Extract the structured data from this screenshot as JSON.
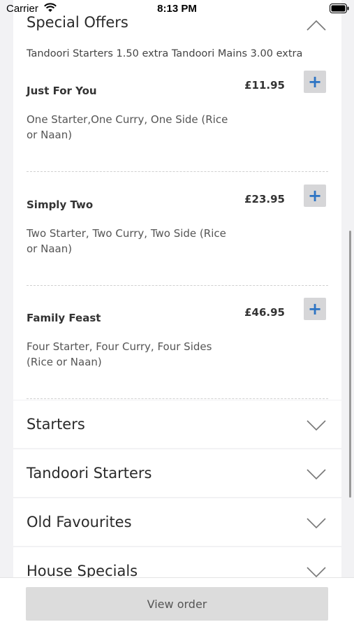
{
  "status_bar": {
    "carrier": "Carrier",
    "time": "8:13 PM"
  },
  "special_offers": {
    "title": "Special Offers",
    "note": "Tandoori Starters 1.50 extra Tandoori Mains 3.00 extra",
    "items": [
      {
        "name": "Just For You",
        "price": "£11.95",
        "description": "One Starter,One Curry, One Side (Rice or Naan)",
        "add_label": "+"
      },
      {
        "name": "Simply Two",
        "price": "£23.95",
        "description": "Two Starter, Two Curry, Two Side (Rice or Naan)",
        "add_label": "+"
      },
      {
        "name": "Family Feast",
        "price": "£46.95",
        "description": "Four Starter, Four Curry, Four Sides (Rice or Naan)",
        "add_label": "+"
      }
    ]
  },
  "sections": [
    {
      "title": "Starters"
    },
    {
      "title": "Tandoori Starters"
    },
    {
      "title": "Old Favourites"
    },
    {
      "title": "House Specials"
    }
  ],
  "bottom": {
    "view_order_label": "View order"
  },
  "colors": {
    "accent_plus": "#2d74c4",
    "button_bg": "#d6d6d8",
    "page_bg": "#f2f2f4"
  }
}
